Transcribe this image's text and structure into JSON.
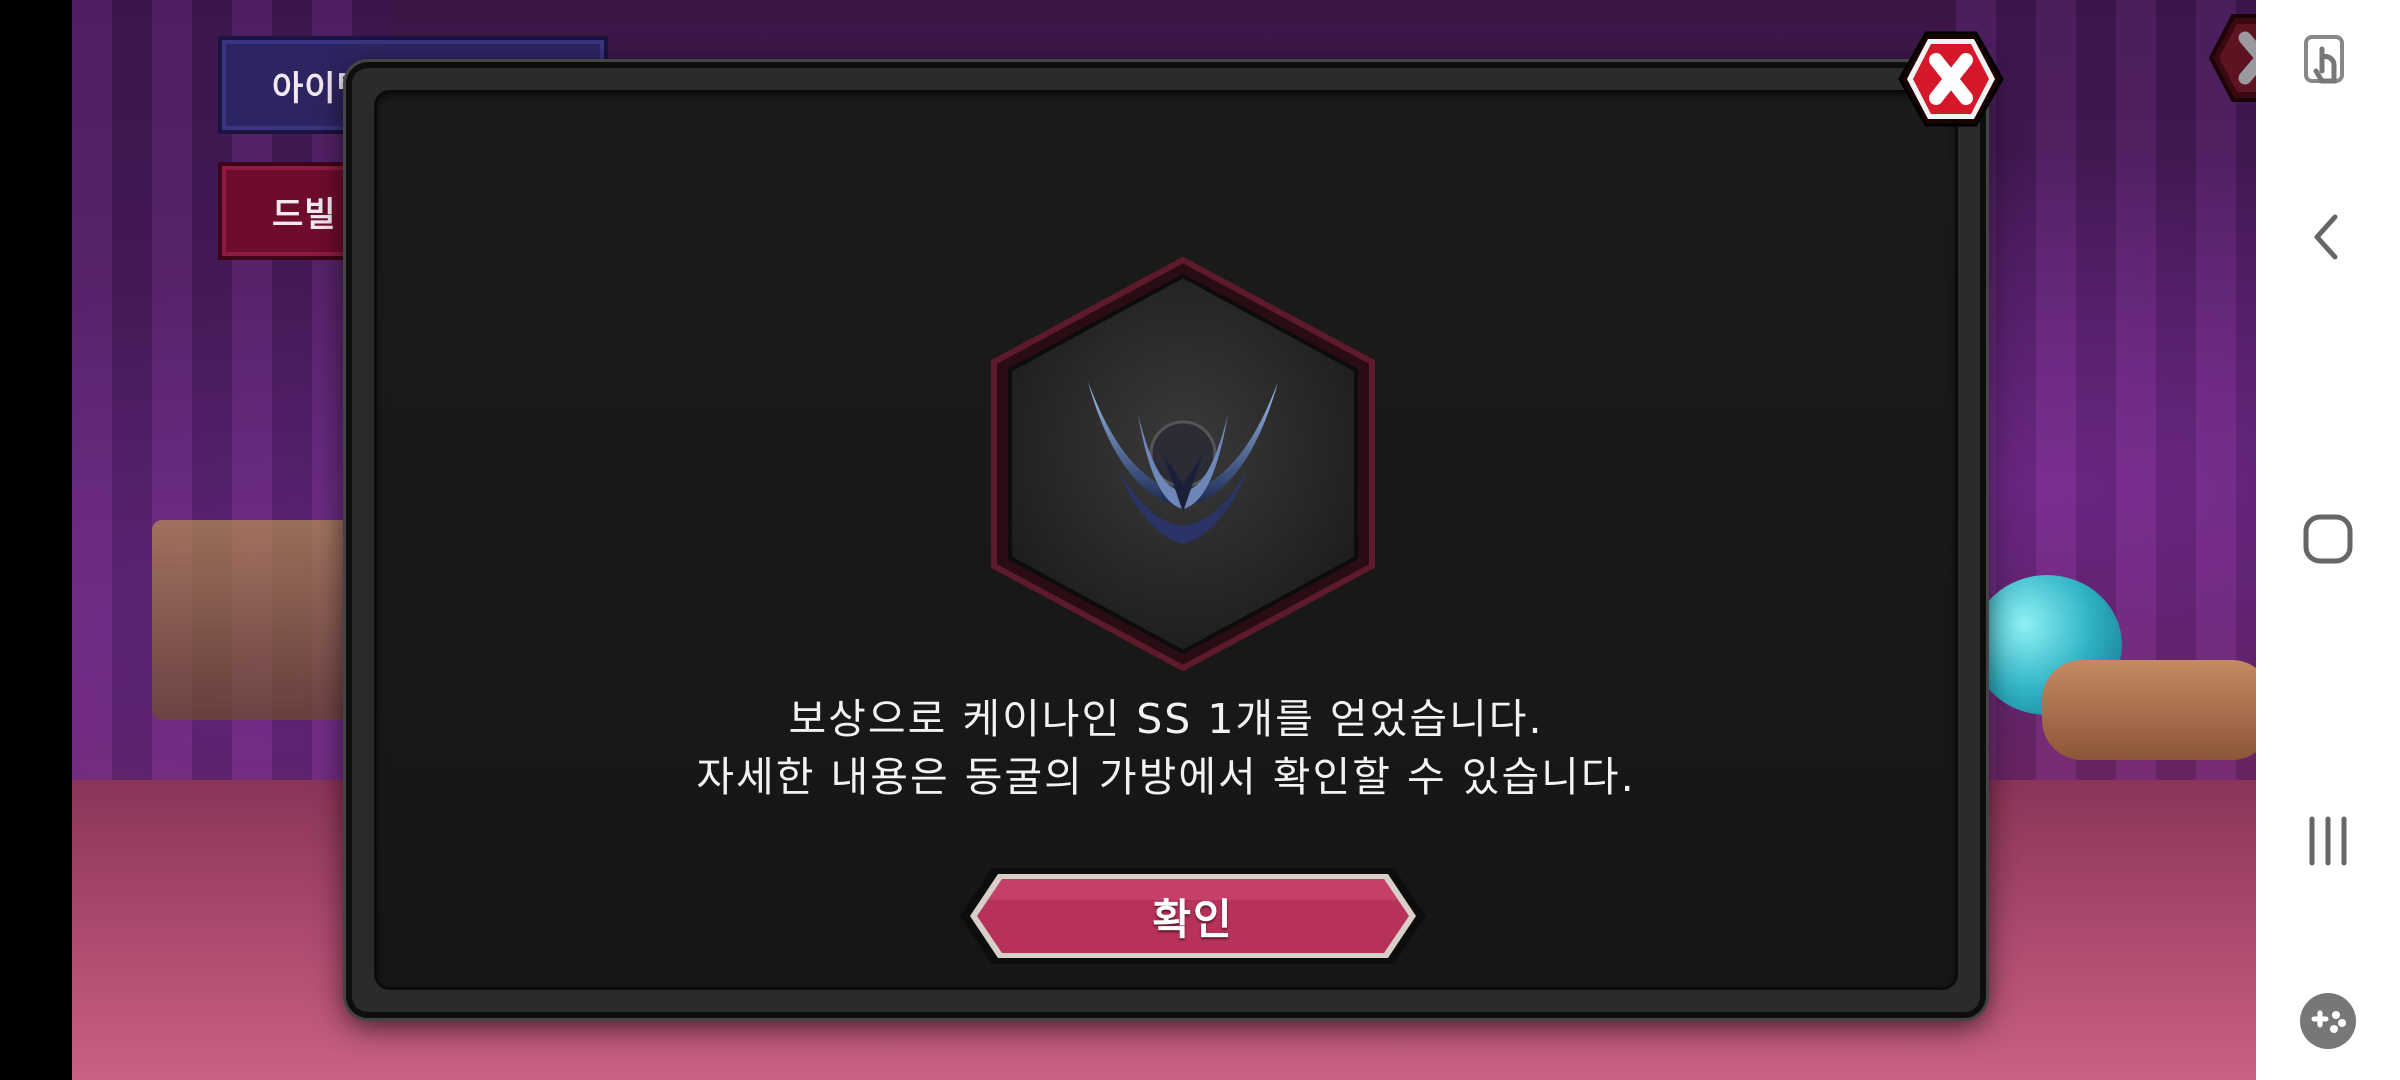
{
  "background": {
    "item_code_button": "아이템코",
    "devil_button": "드빌 가"
  },
  "modal": {
    "reward_item_icon": "kainine-ss-item-icon",
    "message_line1": "보상으로 케이나인 SS 1개를 얻었습니다.",
    "message_line2": "자세한 내용은 동굴의 가방에서 확인할 수 있습니다.",
    "confirm_label": "확인",
    "accent_color": "#c73a64"
  },
  "navbar": {
    "top_icon": "touch-assist-icon",
    "back_icon": "back-icon",
    "home_icon": "home-icon",
    "recents_icon": "recents-icon",
    "game_icon": "game-launcher-icon"
  }
}
